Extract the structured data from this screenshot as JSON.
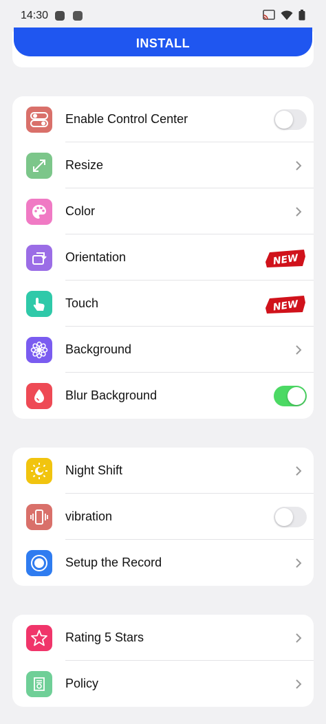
{
  "status_bar": {
    "time": "14:30"
  },
  "install": {
    "label": "INSTALL"
  },
  "groups": [
    {
      "items": [
        {
          "label": "Enable Control Center",
          "icon": "toggles-icon",
          "control": "toggle",
          "on": false
        },
        {
          "label": "Resize",
          "icon": "resize-icon",
          "control": "chevron"
        },
        {
          "label": "Color",
          "icon": "palette-icon",
          "control": "chevron"
        },
        {
          "label": "Orientation",
          "icon": "rotate-icon",
          "control": "new-badge"
        },
        {
          "label": "Touch",
          "icon": "hand-pointer-icon",
          "control": "new-badge"
        },
        {
          "label": "Background",
          "icon": "flower-icon",
          "control": "chevron"
        },
        {
          "label": "Blur Background",
          "icon": "drop-icon",
          "control": "toggle",
          "on": true
        }
      ]
    },
    {
      "items": [
        {
          "label": "Night Shift",
          "icon": "sun-moon-icon",
          "control": "chevron"
        },
        {
          "label": "vibration",
          "icon": "vibration-icon",
          "control": "toggle",
          "on": false
        },
        {
          "label": "Setup the Record",
          "icon": "record-icon",
          "control": "chevron"
        }
      ]
    },
    {
      "items": [
        {
          "label": "Rating 5 Stars",
          "icon": "star-icon",
          "control": "chevron"
        },
        {
          "label": "Policy",
          "icon": "policy-icon",
          "control": "chevron"
        }
      ]
    }
  ],
  "badge_text": "NEW",
  "colors": {
    "install": "#1f56f0",
    "toggle_on": "#4cd964",
    "control_center": "#d9706a",
    "resize": "#7cc68a",
    "color": "#f07ac4",
    "orientation": "#9b6de6",
    "touch": "#2fc9a9",
    "background": "#7a5cf0",
    "blur": "#ee4a55",
    "night_shift": "#f1c40f",
    "vibration": "#d9706a",
    "record": "#2f7cf0",
    "rating": "#f0356a",
    "policy": "#6fcf97"
  }
}
